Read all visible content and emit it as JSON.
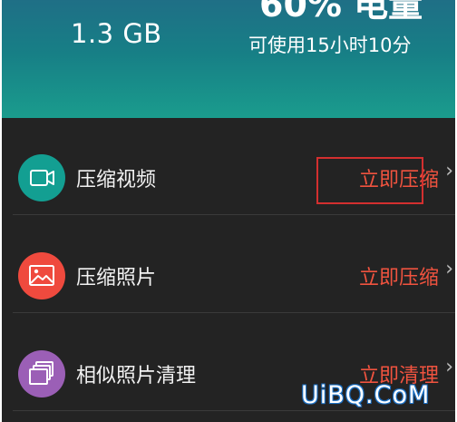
{
  "header": {
    "storage_value": "1.3 GB",
    "battery_percent": "60% 电量",
    "battery_remaining": "可使用15小时10分"
  },
  "items": [
    {
      "label": "压缩视频",
      "action": "立即压缩",
      "icon": "video-camera-icon",
      "color": "#139f92"
    },
    {
      "label": "压缩照片",
      "action": "立即压缩",
      "icon": "image-icon",
      "color": "#ef4a3e"
    },
    {
      "label": "相似照片清理",
      "action": "立即清理",
      "icon": "stacked-photos-icon",
      "color": "#9b5fb6"
    }
  ],
  "chevron": "›",
  "watermark": "UiBQ.CoM",
  "colors": {
    "action_text": "#f0533f",
    "background": "#232323",
    "highlight_border": "#d32f2f"
  }
}
